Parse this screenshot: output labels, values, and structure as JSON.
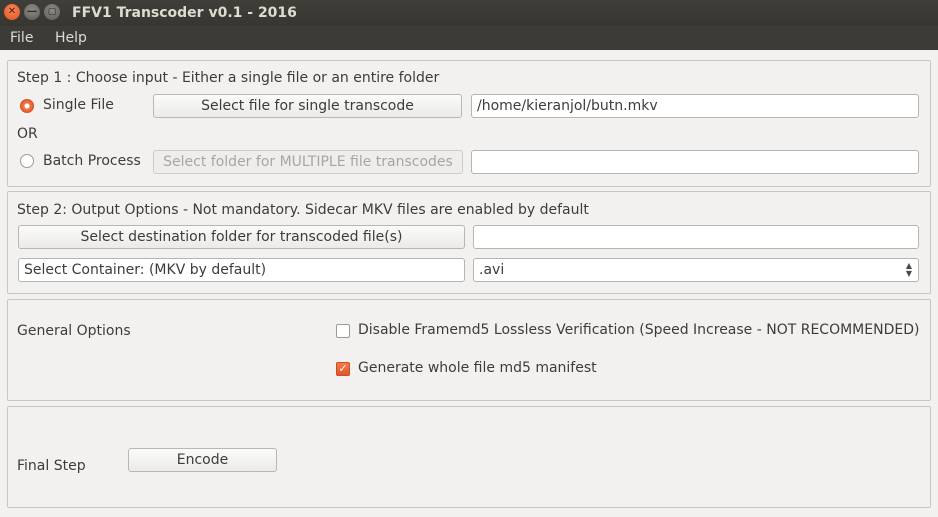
{
  "window": {
    "title": "FFV1 Transcoder v0.1 - 2016",
    "close_icon": "close-icon",
    "minimize_icon": "minimize-icon",
    "maximize_icon": "maximize-icon"
  },
  "menu": {
    "file": "File",
    "help": "Help"
  },
  "step1": {
    "heading": "Step 1 : Choose input - Either a single file or an entire folder",
    "single_label": "Single File",
    "single_selected": true,
    "single_button": "Select file for single transcode",
    "single_path": "/home/kieranjol/butn.mkv",
    "or_label": "OR",
    "batch_label": "Batch Process",
    "batch_selected": false,
    "batch_button": "Select folder for MULTIPLE file transcodes",
    "batch_path": ""
  },
  "step2": {
    "heading": "Step 2: Output Options - Not mandatory. Sidecar MKV files are enabled by default",
    "dest_button": "Select destination folder for transcoded file(s)",
    "dest_path": "",
    "container_label": "Select Container: (MKV by default)",
    "container_value": ".avi"
  },
  "general": {
    "heading": "General Options",
    "disable_framemd5_label": "Disable Framemd5 Lossless Verification (Speed Increase - NOT RECOMMENDED)",
    "disable_framemd5_checked": false,
    "md5_manifest_label": "Generate whole file md5 manifest",
    "md5_manifest_checked": true
  },
  "final": {
    "heading": "Final Step",
    "encode_button": "Encode"
  },
  "colors": {
    "titlebar": "#3c3b37",
    "accent": "#e3592a",
    "background": "#f2f1f0"
  }
}
